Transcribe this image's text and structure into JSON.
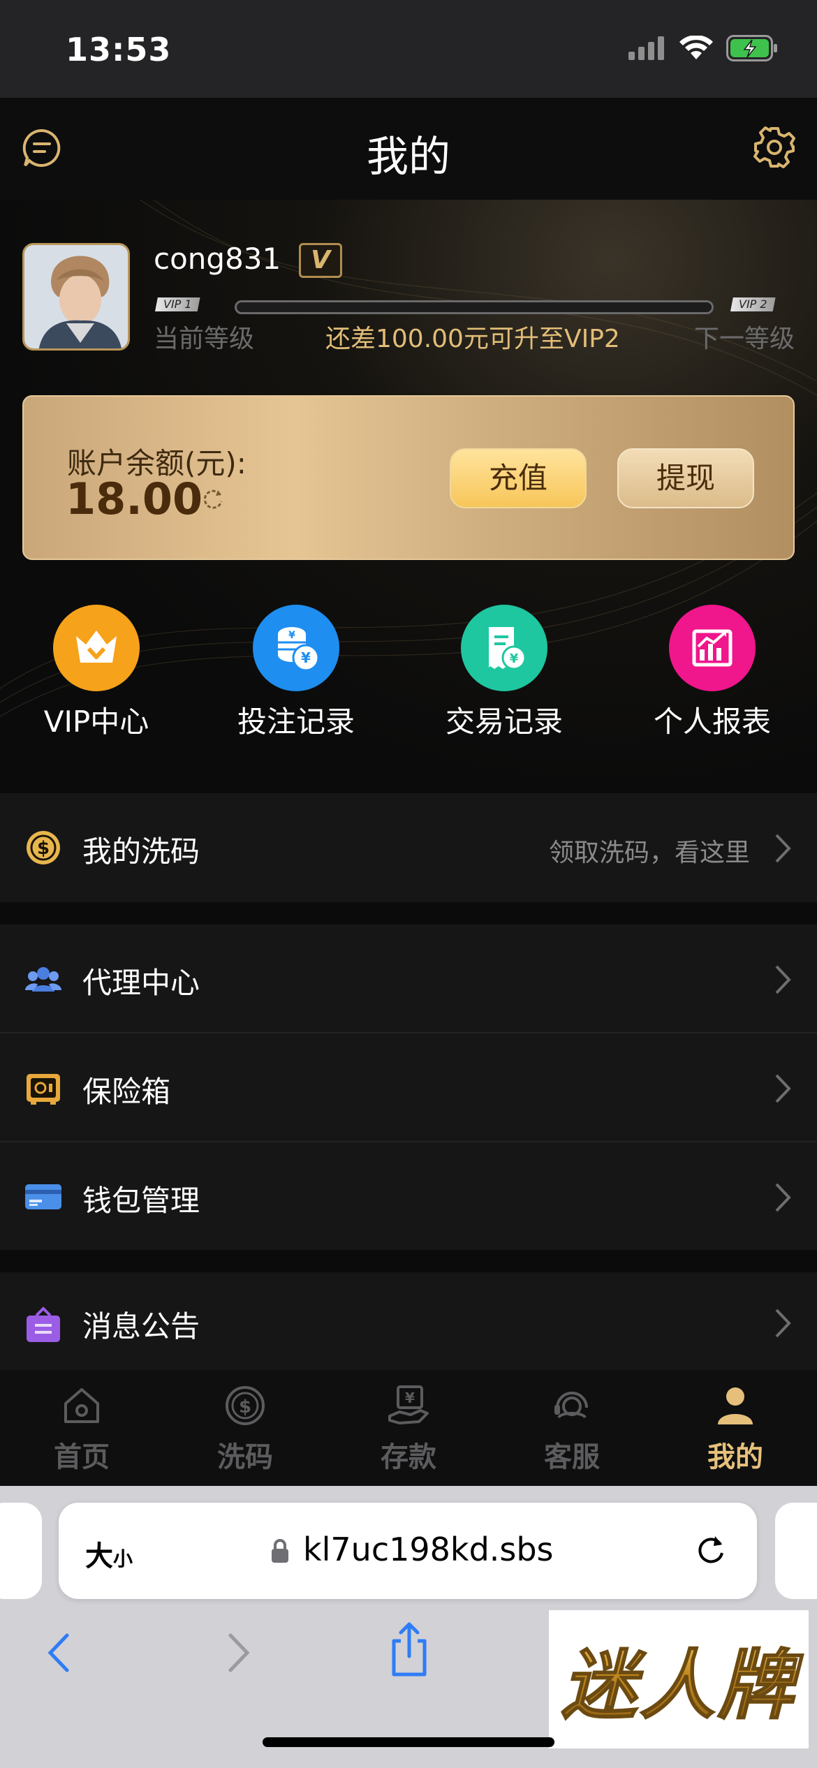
{
  "status_bar": {
    "time": "13:53"
  },
  "header": {
    "title": "我的"
  },
  "profile": {
    "username": "cong831",
    "vip_badge": "V",
    "vip_current_tag": "VIP 1",
    "vip_next_tag": "VIP 2",
    "level_current": "当前等级",
    "level_next": "下一等级",
    "upgrade_hint": "还差100.00元可升至VIP2",
    "progress_fraction": 0
  },
  "balance": {
    "label": "账户余额(元):",
    "value": "18.00",
    "recharge": "充值",
    "withdraw": "提现"
  },
  "quick_actions": [
    {
      "label": "VIP中心",
      "icon": "crown-icon",
      "color": "#f7a21b"
    },
    {
      "label": "投注记录",
      "icon": "coins-icon",
      "color": "#1e8ef0"
    },
    {
      "label": "交易记录",
      "icon": "receipt-icon",
      "color": "#1fc7a0"
    },
    {
      "label": "个人报表",
      "icon": "chart-icon",
      "color": "#f0168c"
    }
  ],
  "rebate": {
    "label": "我的洗码",
    "hint": "领取洗码，看这里"
  },
  "menu": [
    {
      "label": "代理中心",
      "icon": "agents-icon"
    },
    {
      "label": "保险箱",
      "icon": "safe-icon"
    },
    {
      "label": "钱包管理",
      "icon": "wallet-card-icon"
    }
  ],
  "notice": {
    "label": "消息公告"
  },
  "tabs": [
    {
      "label": "首页",
      "icon": "home-icon"
    },
    {
      "label": "洗码",
      "icon": "dollar-coin-icon"
    },
    {
      "label": "存款",
      "icon": "deposit-icon"
    },
    {
      "label": "客服",
      "icon": "support-icon"
    },
    {
      "label": "我的",
      "icon": "user-icon"
    }
  ],
  "browser": {
    "text_size_label": "大",
    "text_size_small": "小",
    "url": "kl7uc198kd.sbs"
  },
  "watermark": "迷人牌",
  "colors": {
    "accent_gold": "#e6c07b",
    "background": "#0b0b0c"
  }
}
